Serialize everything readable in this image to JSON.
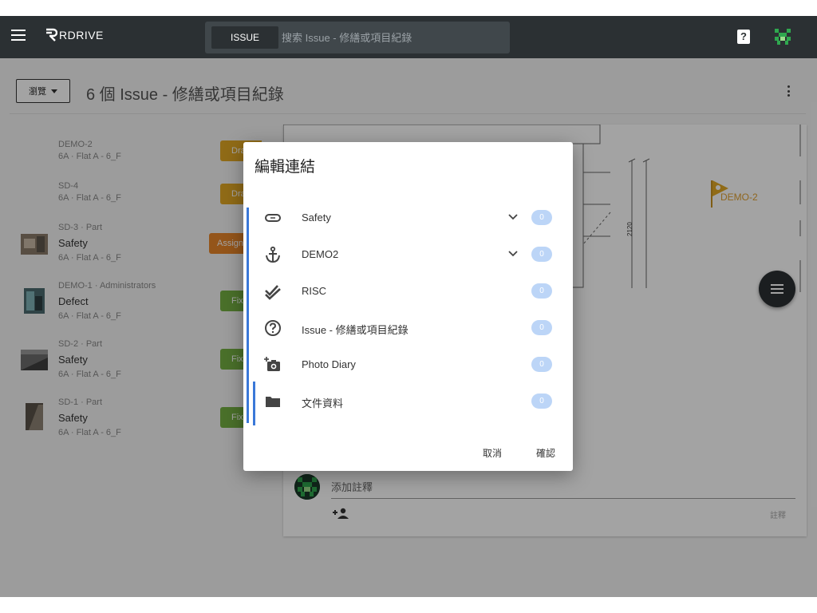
{
  "app": {
    "brand": "RDRIVE",
    "search_chip": "ISSUE",
    "search_placeholder": "搜索 Issue - 修繕或項目紀錄",
    "help_label": "?"
  },
  "header": {
    "browse_label": "瀏覽",
    "title": "6 個 Issue - 修繕或項目紀錄"
  },
  "issues": [
    {
      "sub": "DEMO-2",
      "title": "",
      "location": "6A · Flat A - 6_F",
      "badge": "Draft",
      "badge_color": "#e2a825"
    },
    {
      "sub": "SD-4",
      "title": "",
      "location": "6A · Flat A - 6_F",
      "badge": "Draft",
      "badge_color": "#e2a825"
    },
    {
      "sub": "SD-3 · Part",
      "title": "Safety",
      "location": "6A · Flat A - 6_F",
      "badge": "Assigned",
      "badge_color": "#e8852a"
    },
    {
      "sub": "DEMO-1 · Administrators",
      "title": "Defect",
      "location": "6A · Flat A - 6_F",
      "badge": "Fixed",
      "badge_color": "#74b043"
    },
    {
      "sub": "SD-2 · Part",
      "title": "Safety",
      "location": "6A · Flat A - 6_F",
      "badge": "Fixed",
      "badge_color": "#74b043"
    },
    {
      "sub": "SD-1 · Part",
      "title": "Safety",
      "location": "6A · Flat A - 6_F",
      "badge": "Fixed",
      "badge_color": "#74b043"
    }
  ],
  "drawing": {
    "flag_label": "DEMO-2",
    "dimension_label": "2120"
  },
  "comment": {
    "placeholder": "添加註釋",
    "label": "註釋"
  },
  "dialog": {
    "title": "編輯連結",
    "links": [
      {
        "label": "Safety",
        "icon": "goggles-icon",
        "count": "0",
        "expandable": true
      },
      {
        "label": "DEMO2",
        "icon": "anchor-icon",
        "count": "0",
        "expandable": true
      },
      {
        "label": "RISC",
        "icon": "double-check-icon",
        "count": "0",
        "expandable": false
      },
      {
        "label": "Issue - 修繕或項目紀錄",
        "icon": "help-circle-icon",
        "count": "0",
        "expandable": false
      },
      {
        "label": "Photo Diary",
        "icon": "add-camera-icon",
        "count": "0",
        "expandable": false
      },
      {
        "label": "文件資料",
        "icon": "folder-icon",
        "count": "0",
        "expandable": false
      }
    ],
    "cancel_label": "取消",
    "confirm_label": "確認"
  },
  "colors": {
    "appbar": "#2b3033",
    "accent_blue": "#3a78d8",
    "count_badge": "#bcd5f7"
  }
}
